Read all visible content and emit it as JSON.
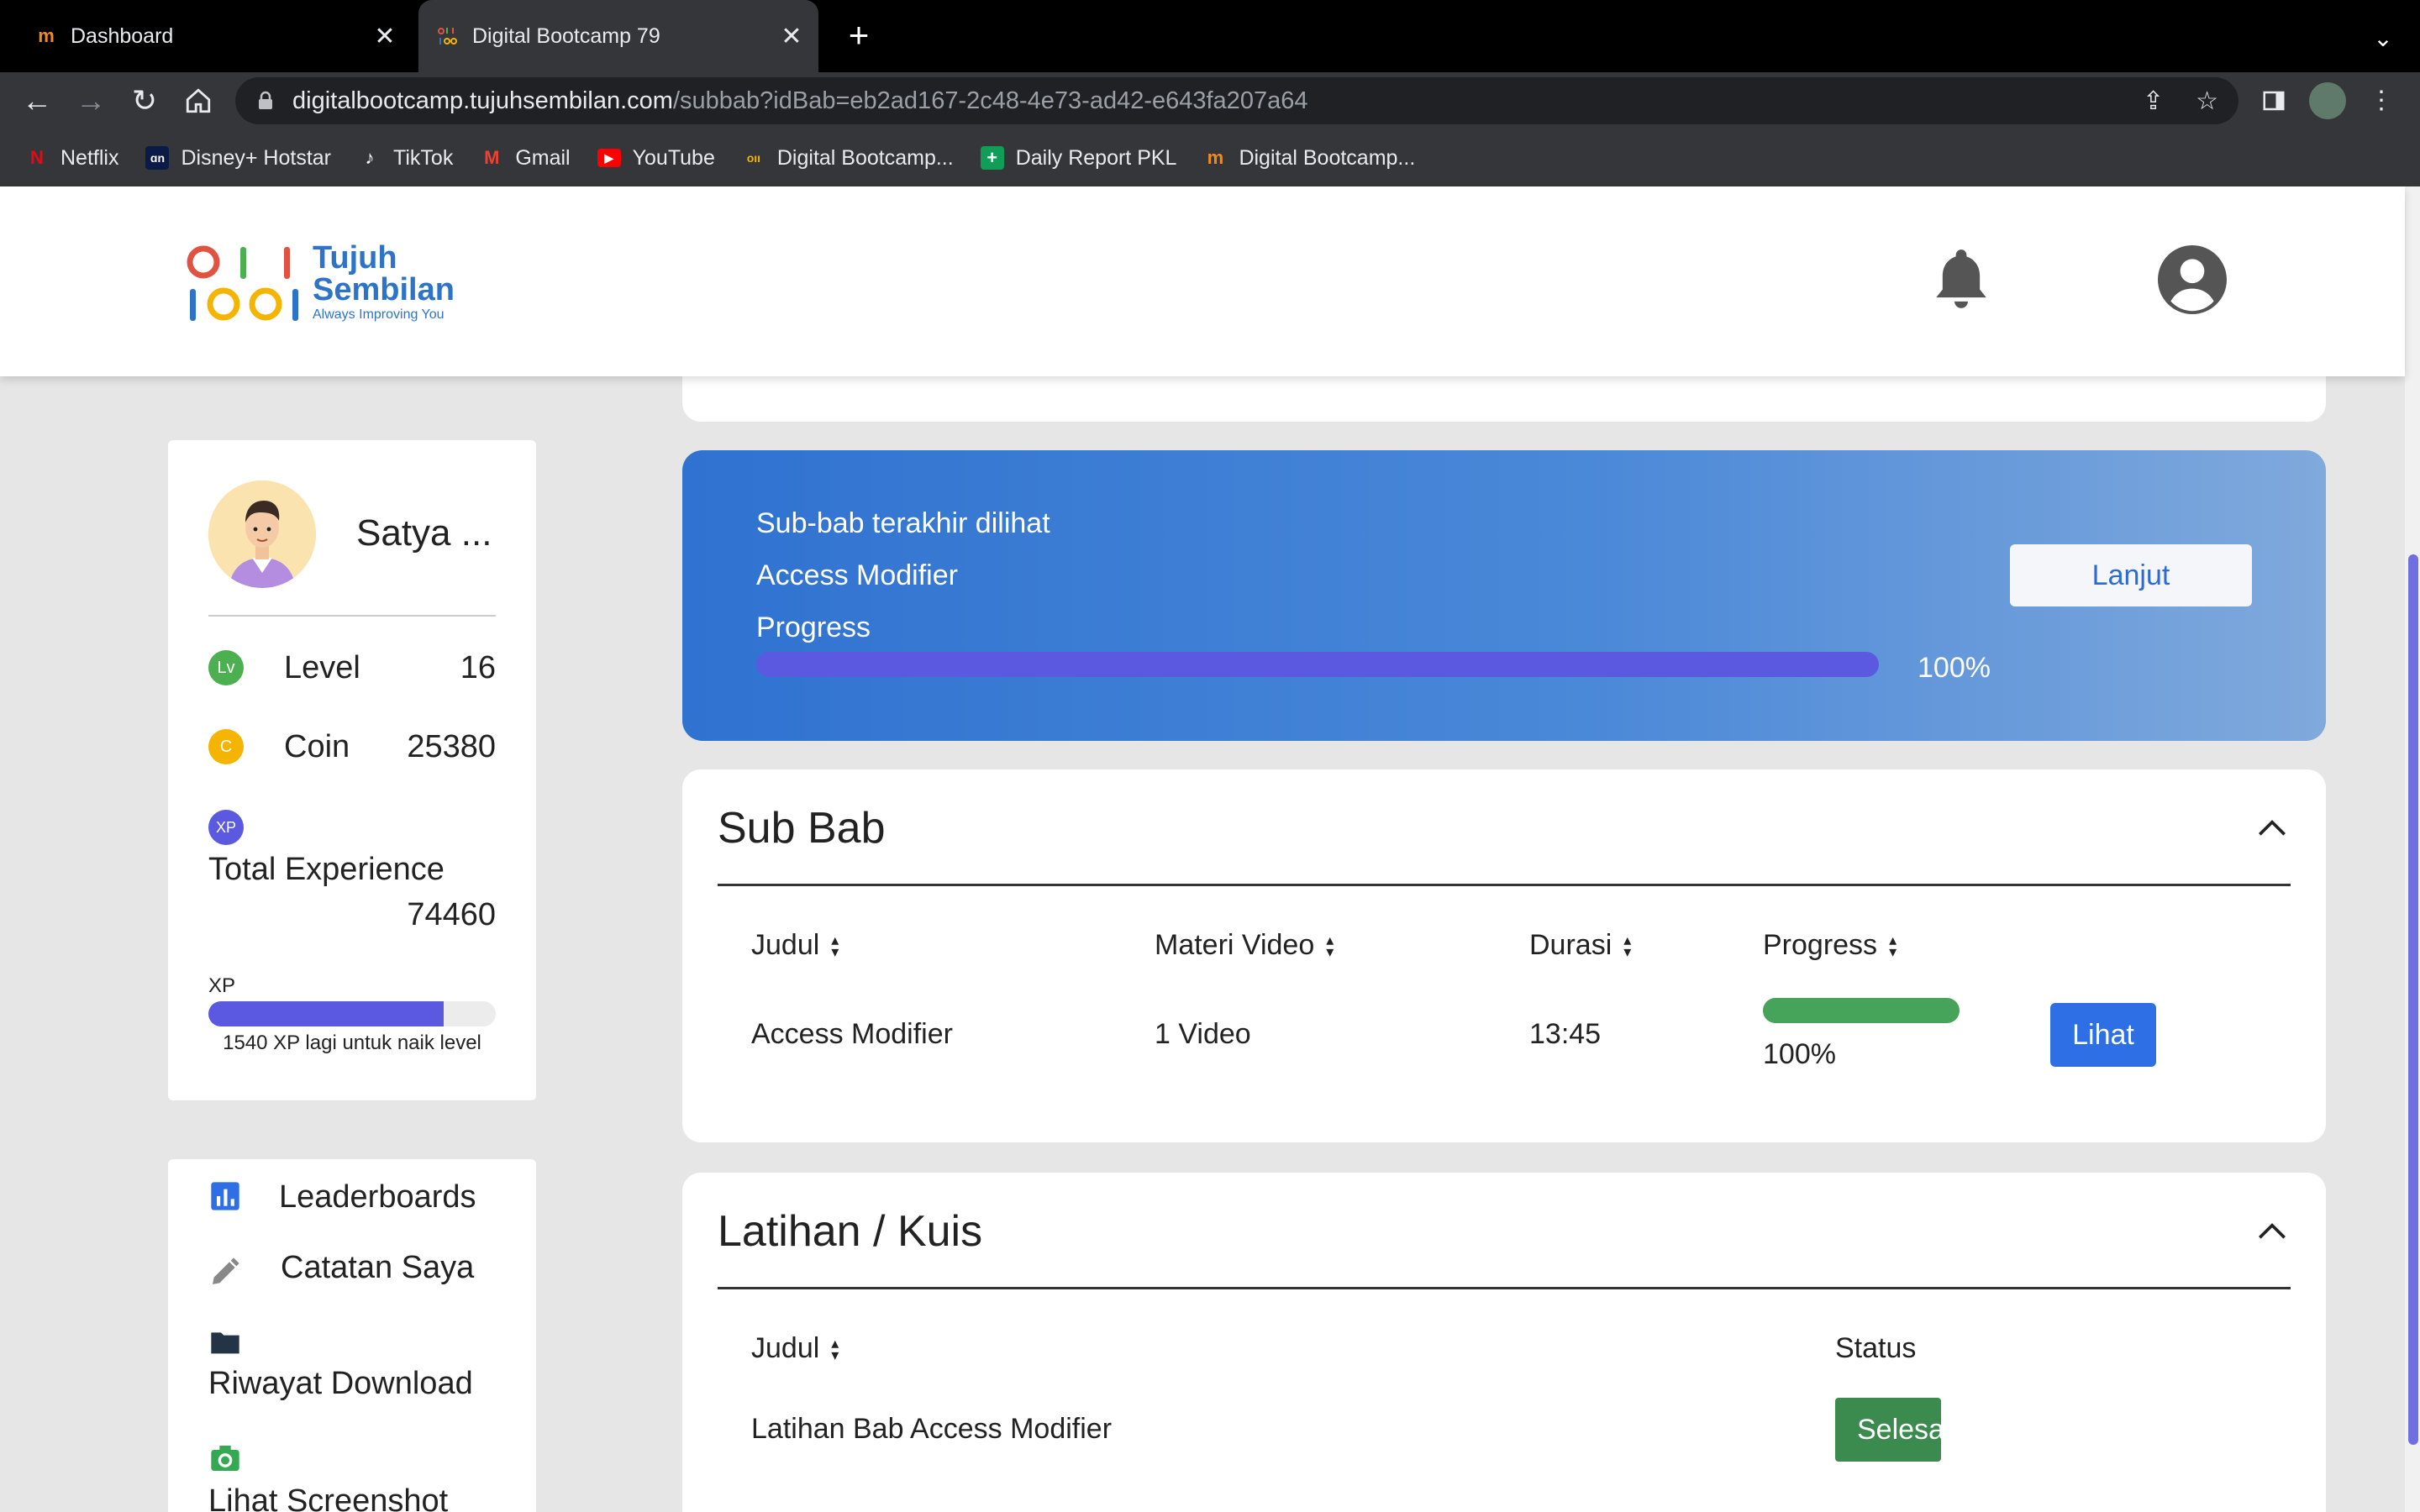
{
  "browser": {
    "tabs": [
      {
        "title": "Dashboard",
        "active": false
      },
      {
        "title": "Digital Bootcamp 79",
        "active": true
      }
    ],
    "url": {
      "host": "digitalbootcamp.tujuhsembilan.com",
      "path": "/subbab?idBab=eb2ad167-2c48-4e73-ad42-e643fa207a64"
    },
    "bookmarks": [
      {
        "label": "Netflix",
        "icon": "netflix-icon"
      },
      {
        "label": "Disney+ Hotstar",
        "icon": "hotstar-icon"
      },
      {
        "label": "TikTok",
        "icon": "tiktok-icon"
      },
      {
        "label": "Gmail",
        "icon": "gmail-icon"
      },
      {
        "label": "YouTube",
        "icon": "youtube-icon"
      },
      {
        "label": "Digital Bootcamp...",
        "icon": "bootcamp-icon"
      },
      {
        "label": "Daily Report PKL",
        "icon": "sheets-icon"
      },
      {
        "label": "Digital Bootcamp...",
        "icon": "bootcamp-icon"
      }
    ]
  },
  "header": {
    "logo": {
      "line1": "Tujuh",
      "line2": "Sembilan",
      "tagline": "Always Improving You"
    }
  },
  "profile": {
    "name": "Satya ...",
    "level_label": "Level",
    "level_value": "16",
    "level_badge": "Lv",
    "coin_label": "Coin",
    "coin_value": "25380",
    "coin_badge": "C",
    "xp_badge": "XP",
    "exp_label": "Total Experience",
    "exp_value": "74460",
    "xp_bar_label": "XP",
    "xp_progress": 0.82,
    "xp_note": "1540 XP lagi untuk naik level"
  },
  "menu": {
    "items": [
      {
        "label": "Leaderboards",
        "icon": "bar-chart-icon"
      },
      {
        "label": "Catatan Saya",
        "icon": "pencil-icon"
      },
      {
        "label": "Riwayat Download",
        "icon": "folder-icon"
      },
      {
        "label": "Lihat Screenshot",
        "icon": "camera-icon"
      }
    ]
  },
  "last_seen": {
    "heading": "Sub-bab terakhir dilihat",
    "title": "Access Modifier",
    "progress_label": "Progress",
    "progress_value": 100,
    "progress_text": "100%",
    "button": "Lanjut"
  },
  "subbab": {
    "title": "Sub Bab",
    "columns": [
      "Judul",
      "Materi Video",
      "Durasi",
      "Progress"
    ],
    "rows": [
      {
        "judul": "Access Modifier",
        "materi": "1 Video",
        "durasi": "13:45",
        "progress_value": 100,
        "progress_text": "100%",
        "action": "Lihat"
      }
    ]
  },
  "latihan": {
    "title": "Latihan / Kuis",
    "columns": [
      "Judul",
      "Status"
    ],
    "rows": [
      {
        "judul": "Latihan Bab Access Modifier",
        "status": "Selesai"
      }
    ]
  },
  "colors": {
    "accent": "#2f6fe6",
    "progress": "#5b59e0",
    "success": "#45a35a",
    "done_badge": "#3b8a4e"
  }
}
